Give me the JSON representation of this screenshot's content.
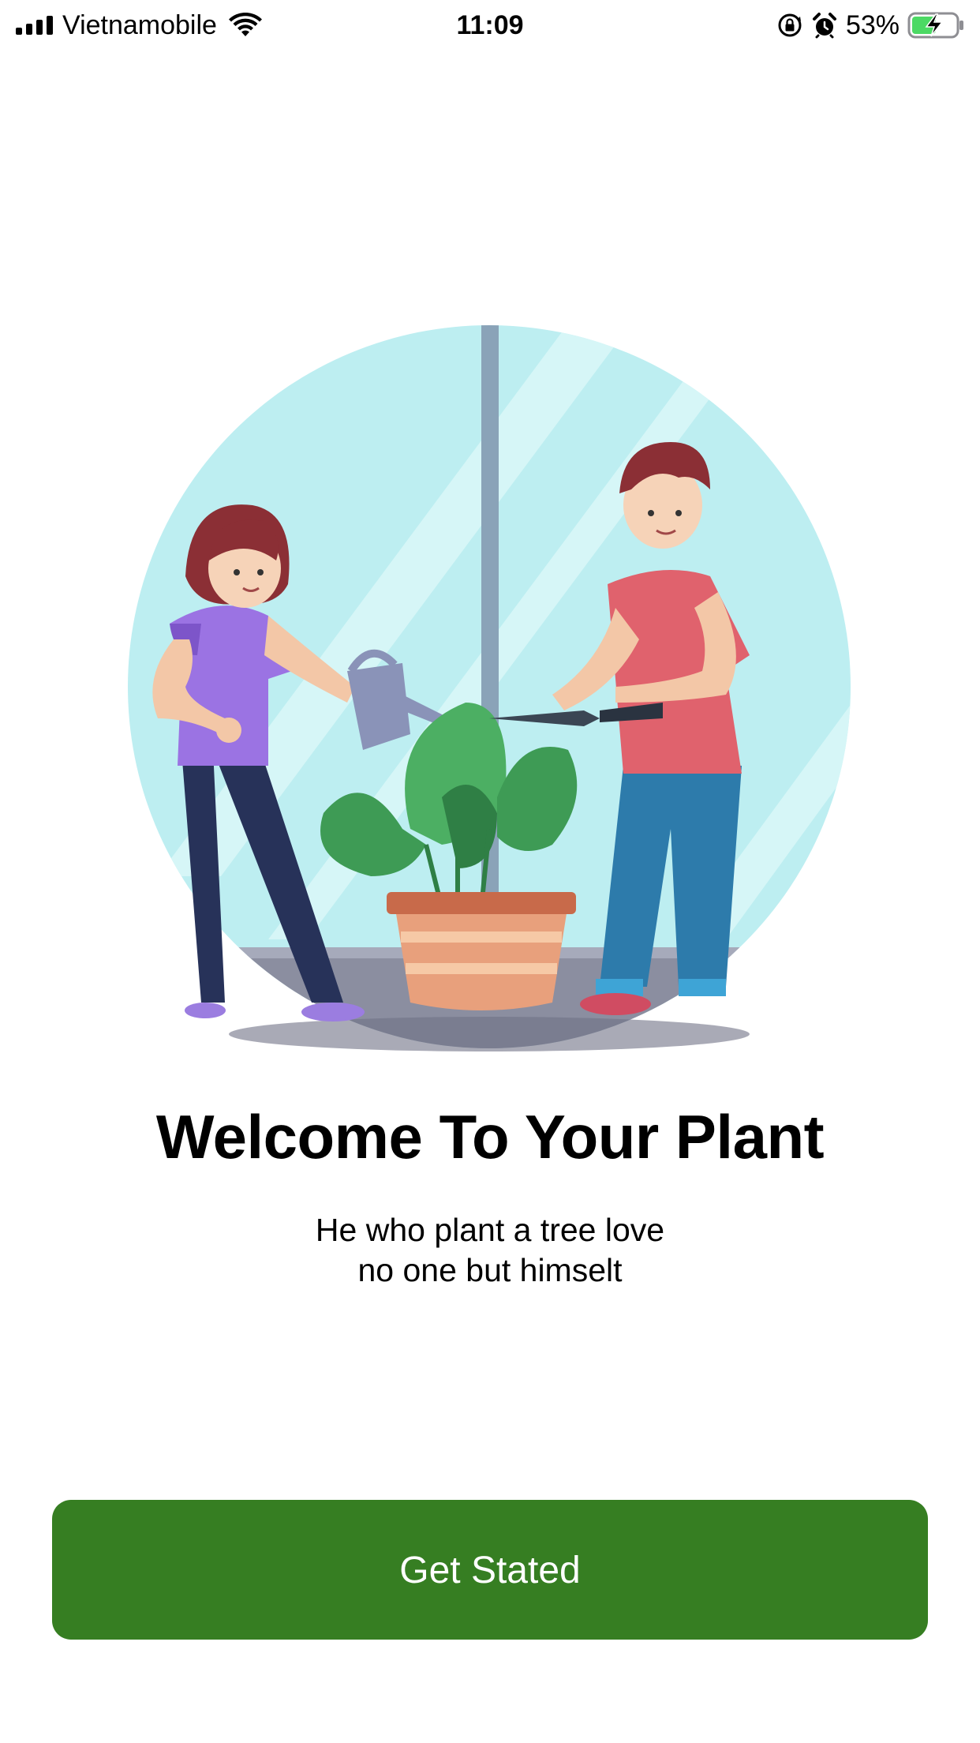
{
  "status_bar": {
    "carrier": "Vietnamobile",
    "time": "11:09",
    "battery_percent": "53%",
    "icons": [
      "signal-icon",
      "wifi-icon",
      "orientation-lock-icon",
      "alarm-icon",
      "battery-charging-icon"
    ]
  },
  "onboarding": {
    "title": "Welcome To Your Plant",
    "subtitle_line1": "He who plant a tree love",
    "subtitle_line2": "no one but himselt",
    "button_label": "Get Stated"
  },
  "colors": {
    "button_bg": "#367e22",
    "battery_fill": "#4cd964"
  }
}
